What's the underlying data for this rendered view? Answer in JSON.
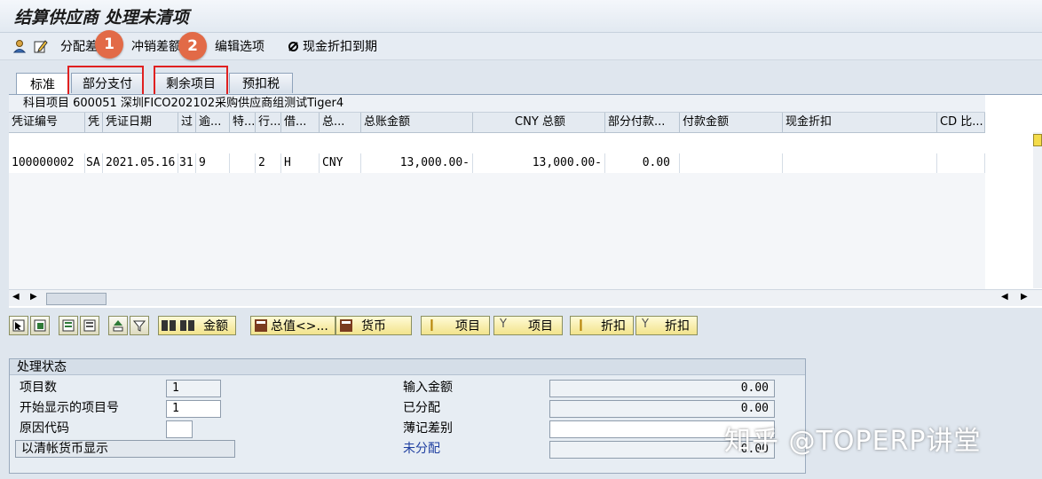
{
  "window": {
    "title": "结算供应商 处理未清项"
  },
  "toolbar": {
    "items": [
      {
        "label": "分配差"
      },
      {
        "label": "冲销差额"
      },
      {
        "label": "编辑选项"
      },
      {
        "label": "现金折扣到期"
      }
    ]
  },
  "markers": [
    "1",
    "2"
  ],
  "tabs": [
    "标准",
    "部分支付",
    "剩余项目",
    "预扣税"
  ],
  "grid": {
    "caption": "科目项目 600051 深圳FICO202102采购供应商组测试Tiger4",
    "columns": [
      "凭证编号",
      "凭",
      "凭证日期",
      "过",
      "逾...",
      "特...",
      "行...",
      "借...",
      "总...",
      "总账金额",
      "CNY 总额",
      "部分付款...",
      "付款金额",
      "现金折扣",
      "CD 比..."
    ],
    "rows": [
      [
        "100000002",
        "SA",
        "2021.05.16",
        "31",
        "9",
        "",
        "2",
        "H",
        "CNY",
        "13,000.00-",
        "13,000.00-",
        "0.00",
        "",
        "",
        ""
      ]
    ]
  },
  "buttons": {
    "amount": "金额",
    "total": "总值<>...",
    "currency": "货币",
    "item1": "项目",
    "item2": "项目",
    "discount1": "折扣",
    "discount2": "折扣"
  },
  "status": {
    "title": "处理状态",
    "item_count_label": "项目数",
    "item_count": "1",
    "start_label": "开始显示的项目号",
    "start_value": "1",
    "reason_label": "原因代码",
    "reason_value": "",
    "clearing_currency": "以清帐货币显示",
    "input_amount_label": "输入金额",
    "input_amount": "0.00",
    "assigned_label": "已分配",
    "assigned": "0.00",
    "diff_label": "薄记差别",
    "diff": "",
    "unassigned_label": "未分配",
    "unassigned": "0.00"
  },
  "watermark": "知乎 @TOPERP讲堂",
  "colors": {
    "marker": "#e26a47",
    "highlight": "#e02020",
    "unassigned_label": "#1f3fa0"
  }
}
